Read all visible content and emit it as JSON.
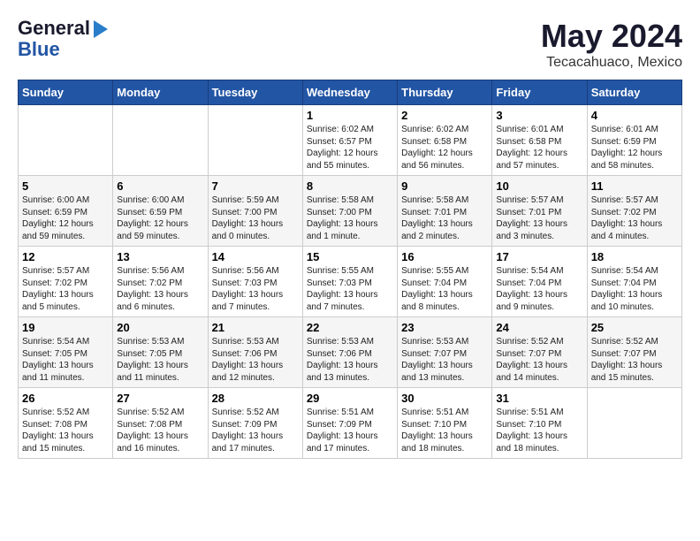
{
  "logo": {
    "line1": "General",
    "line2": "Blue"
  },
  "title": "May 2024",
  "subtitle": "Tecacahuaco, Mexico",
  "days_header": [
    "Sunday",
    "Monday",
    "Tuesday",
    "Wednesday",
    "Thursday",
    "Friday",
    "Saturday"
  ],
  "weeks": [
    [
      {
        "day": "",
        "sunrise": "",
        "sunset": "",
        "daylight": ""
      },
      {
        "day": "",
        "sunrise": "",
        "sunset": "",
        "daylight": ""
      },
      {
        "day": "",
        "sunrise": "",
        "sunset": "",
        "daylight": ""
      },
      {
        "day": "1",
        "sunrise": "Sunrise: 6:02 AM",
        "sunset": "Sunset: 6:57 PM",
        "daylight": "Daylight: 12 hours and 55 minutes."
      },
      {
        "day": "2",
        "sunrise": "Sunrise: 6:02 AM",
        "sunset": "Sunset: 6:58 PM",
        "daylight": "Daylight: 12 hours and 56 minutes."
      },
      {
        "day": "3",
        "sunrise": "Sunrise: 6:01 AM",
        "sunset": "Sunset: 6:58 PM",
        "daylight": "Daylight: 12 hours and 57 minutes."
      },
      {
        "day": "4",
        "sunrise": "Sunrise: 6:01 AM",
        "sunset": "Sunset: 6:59 PM",
        "daylight": "Daylight: 12 hours and 58 minutes."
      }
    ],
    [
      {
        "day": "5",
        "sunrise": "Sunrise: 6:00 AM",
        "sunset": "Sunset: 6:59 PM",
        "daylight": "Daylight: 12 hours and 59 minutes."
      },
      {
        "day": "6",
        "sunrise": "Sunrise: 6:00 AM",
        "sunset": "Sunset: 6:59 PM",
        "daylight": "Daylight: 12 hours and 59 minutes."
      },
      {
        "day": "7",
        "sunrise": "Sunrise: 5:59 AM",
        "sunset": "Sunset: 7:00 PM",
        "daylight": "Daylight: 13 hours and 0 minutes."
      },
      {
        "day": "8",
        "sunrise": "Sunrise: 5:58 AM",
        "sunset": "Sunset: 7:00 PM",
        "daylight": "Daylight: 13 hours and 1 minute."
      },
      {
        "day": "9",
        "sunrise": "Sunrise: 5:58 AM",
        "sunset": "Sunset: 7:01 PM",
        "daylight": "Daylight: 13 hours and 2 minutes."
      },
      {
        "day": "10",
        "sunrise": "Sunrise: 5:57 AM",
        "sunset": "Sunset: 7:01 PM",
        "daylight": "Daylight: 13 hours and 3 minutes."
      },
      {
        "day": "11",
        "sunrise": "Sunrise: 5:57 AM",
        "sunset": "Sunset: 7:02 PM",
        "daylight": "Daylight: 13 hours and 4 minutes."
      }
    ],
    [
      {
        "day": "12",
        "sunrise": "Sunrise: 5:57 AM",
        "sunset": "Sunset: 7:02 PM",
        "daylight": "Daylight: 13 hours and 5 minutes."
      },
      {
        "day": "13",
        "sunrise": "Sunrise: 5:56 AM",
        "sunset": "Sunset: 7:02 PM",
        "daylight": "Daylight: 13 hours and 6 minutes."
      },
      {
        "day": "14",
        "sunrise": "Sunrise: 5:56 AM",
        "sunset": "Sunset: 7:03 PM",
        "daylight": "Daylight: 13 hours and 7 minutes."
      },
      {
        "day": "15",
        "sunrise": "Sunrise: 5:55 AM",
        "sunset": "Sunset: 7:03 PM",
        "daylight": "Daylight: 13 hours and 7 minutes."
      },
      {
        "day": "16",
        "sunrise": "Sunrise: 5:55 AM",
        "sunset": "Sunset: 7:04 PM",
        "daylight": "Daylight: 13 hours and 8 minutes."
      },
      {
        "day": "17",
        "sunrise": "Sunrise: 5:54 AM",
        "sunset": "Sunset: 7:04 PM",
        "daylight": "Daylight: 13 hours and 9 minutes."
      },
      {
        "day": "18",
        "sunrise": "Sunrise: 5:54 AM",
        "sunset": "Sunset: 7:04 PM",
        "daylight": "Daylight: 13 hours and 10 minutes."
      }
    ],
    [
      {
        "day": "19",
        "sunrise": "Sunrise: 5:54 AM",
        "sunset": "Sunset: 7:05 PM",
        "daylight": "Daylight: 13 hours and 11 minutes."
      },
      {
        "day": "20",
        "sunrise": "Sunrise: 5:53 AM",
        "sunset": "Sunset: 7:05 PM",
        "daylight": "Daylight: 13 hours and 11 minutes."
      },
      {
        "day": "21",
        "sunrise": "Sunrise: 5:53 AM",
        "sunset": "Sunset: 7:06 PM",
        "daylight": "Daylight: 13 hours and 12 minutes."
      },
      {
        "day": "22",
        "sunrise": "Sunrise: 5:53 AM",
        "sunset": "Sunset: 7:06 PM",
        "daylight": "Daylight: 13 hours and 13 minutes."
      },
      {
        "day": "23",
        "sunrise": "Sunrise: 5:53 AM",
        "sunset": "Sunset: 7:07 PM",
        "daylight": "Daylight: 13 hours and 13 minutes."
      },
      {
        "day": "24",
        "sunrise": "Sunrise: 5:52 AM",
        "sunset": "Sunset: 7:07 PM",
        "daylight": "Daylight: 13 hours and 14 minutes."
      },
      {
        "day": "25",
        "sunrise": "Sunrise: 5:52 AM",
        "sunset": "Sunset: 7:07 PM",
        "daylight": "Daylight: 13 hours and 15 minutes."
      }
    ],
    [
      {
        "day": "26",
        "sunrise": "Sunrise: 5:52 AM",
        "sunset": "Sunset: 7:08 PM",
        "daylight": "Daylight: 13 hours and 15 minutes."
      },
      {
        "day": "27",
        "sunrise": "Sunrise: 5:52 AM",
        "sunset": "Sunset: 7:08 PM",
        "daylight": "Daylight: 13 hours and 16 minutes."
      },
      {
        "day": "28",
        "sunrise": "Sunrise: 5:52 AM",
        "sunset": "Sunset: 7:09 PM",
        "daylight": "Daylight: 13 hours and 17 minutes."
      },
      {
        "day": "29",
        "sunrise": "Sunrise: 5:51 AM",
        "sunset": "Sunset: 7:09 PM",
        "daylight": "Daylight: 13 hours and 17 minutes."
      },
      {
        "day": "30",
        "sunrise": "Sunrise: 5:51 AM",
        "sunset": "Sunset: 7:10 PM",
        "daylight": "Daylight: 13 hours and 18 minutes."
      },
      {
        "day": "31",
        "sunrise": "Sunrise: 5:51 AM",
        "sunset": "Sunset: 7:10 PM",
        "daylight": "Daylight: 13 hours and 18 minutes."
      },
      {
        "day": "",
        "sunrise": "",
        "sunset": "",
        "daylight": ""
      }
    ]
  ]
}
